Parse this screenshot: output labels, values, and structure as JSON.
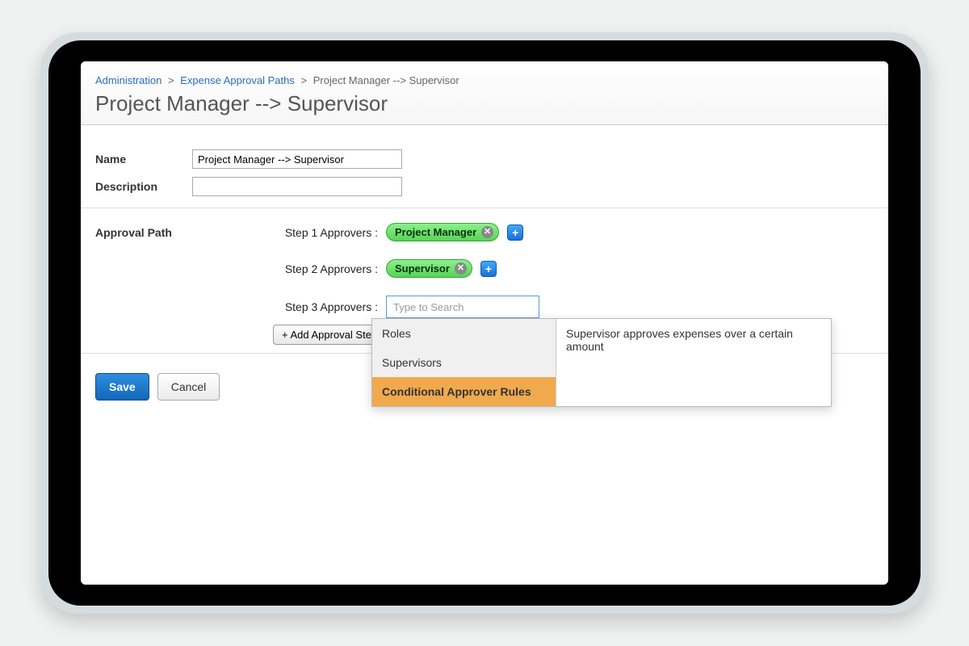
{
  "breadcrumb": {
    "items": [
      "Administration",
      "Expense Approval Paths",
      "Project Manager --> Supervisor"
    ],
    "sep": ">"
  },
  "page_title": "Project Manager --> Supervisor",
  "form": {
    "name_label": "Name",
    "name_value": "Project Manager --> Supervisor",
    "description_label": "Description",
    "description_value": ""
  },
  "approval_path": {
    "section_label": "Approval Path",
    "steps": [
      {
        "label": "Step 1 Approvers :",
        "chip": "Project Manager"
      },
      {
        "label": "Step 2 Approvers :",
        "chip": "Supervisor"
      },
      {
        "label": "Step 3 Approvers :",
        "search_placeholder": "Type to Search"
      }
    ],
    "add_step_label": "+ Add Approval Step"
  },
  "dropdown": {
    "categories": [
      "Roles",
      "Supervisors",
      "Conditional Approver Rules"
    ],
    "active_index": 2,
    "detail": "Supervisor approves expenses over a certain amount"
  },
  "actions": {
    "save": "Save",
    "cancel": "Cancel"
  }
}
